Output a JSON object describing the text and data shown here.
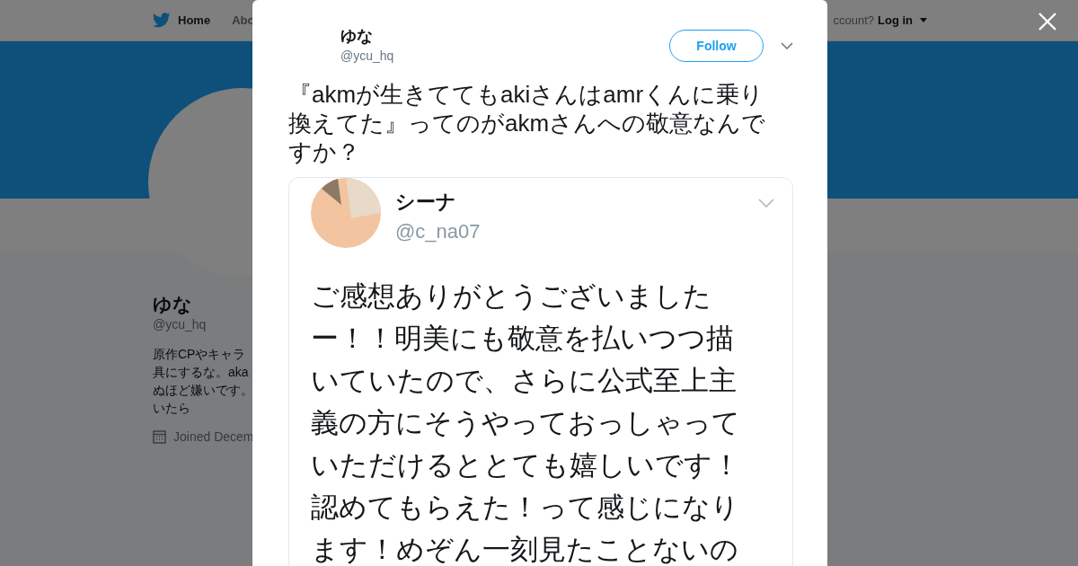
{
  "background_page": {
    "nav": [
      {
        "label": "Home"
      },
      {
        "label": "Abo"
      }
    ],
    "account_prompt": "ccount?",
    "login": "Log in",
    "profile": {
      "name": "ゆな",
      "handle": "@ycu_hq",
      "bio_lines": [
        "原作CPやキャラ",
        "具にするな。aka",
        "ぬほど嫌いです。",
        "いたら"
      ],
      "joined": "Joined Decem"
    }
  },
  "modal": {
    "author": {
      "name": "ゆな",
      "handle": "@ycu_hq"
    },
    "follow_button": "Follow",
    "text": "『akmが生きててもakiさんはamrくんに乗り換えてた』ってのがakmさんへの敬意なんですか？",
    "attached_screenshot": {
      "name": "シーナ",
      "handle": "@c_na07",
      "text_lines": [
        "ご感想ありがとうございました",
        "ー！！明美にも敬意を払いつつ描",
        "いていたので、さらに公式至上主",
        "義の方にそうやっておっしゃって",
        "いただけるととても嬉しいです！",
        "認めてもらえた！って感じになり",
        "ます！めぞん一刻見たことないの"
      ]
    }
  }
}
